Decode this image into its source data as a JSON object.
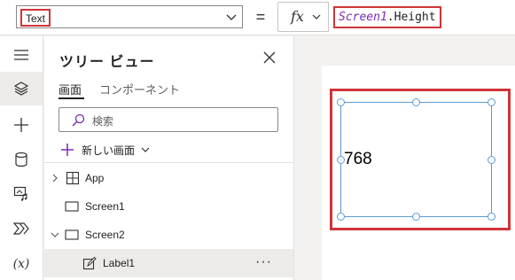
{
  "formula_bar": {
    "property": "Text",
    "equals": "=",
    "fx": "fx",
    "formula_screen": "Screen1",
    "formula_property": ".Height"
  },
  "rail": {
    "items": [
      "hamburger-icon",
      "layers-icon",
      "plus-icon",
      "database-icon",
      "media-icon",
      "power-automate-icon",
      "variable-icon"
    ],
    "variables_label": "(x)"
  },
  "tree": {
    "title": "ツリー ビュー",
    "tabs": [
      {
        "label": "画面",
        "active": true
      },
      {
        "label": "コンポーネント",
        "active": false
      }
    ],
    "search_placeholder": "検索",
    "new_screen_label": "新しい画面",
    "rows": [
      {
        "label": "App",
        "icon": "app-icon",
        "expand": "collapsed"
      },
      {
        "label": "Screen1",
        "icon": "screen-icon",
        "expand": "none"
      },
      {
        "label": "Screen2",
        "icon": "screen-icon",
        "expand": "expanded"
      },
      {
        "label": "Label1",
        "icon": "label-edit-icon",
        "expand": "none",
        "selected": true
      }
    ],
    "more_label": "···"
  },
  "canvas": {
    "label_value": "768"
  },
  "colors": {
    "highlight": "#d13438",
    "selection": "#5b9bd5",
    "accent": "#7a2bb3"
  }
}
